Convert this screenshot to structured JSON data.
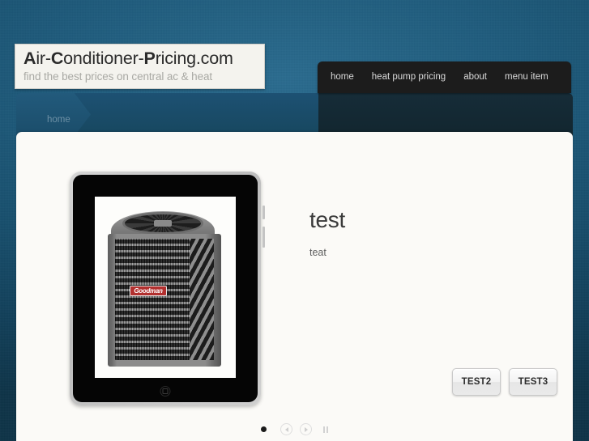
{
  "site": {
    "logo": {
      "title_parts": [
        {
          "text": "A",
          "bold": true
        },
        {
          "text": "ir-",
          "bold": false
        },
        {
          "text": "C",
          "bold": true
        },
        {
          "text": "onditioner-",
          "bold": false
        },
        {
          "text": "P",
          "bold": true
        },
        {
          "text": "ricing.com",
          "bold": false
        }
      ],
      "title_plain": "Air-Conditioner-Pricing.com",
      "tagline": "find the best prices on central ac & heat"
    },
    "background_color": "#1f5c7d",
    "accent_color": "#225a7c"
  },
  "nav": {
    "items": [
      {
        "label": "home"
      },
      {
        "label": "heat pump pricing"
      },
      {
        "label": "about"
      },
      {
        "label": "menu item"
      }
    ]
  },
  "breadcrumb": {
    "current": "home"
  },
  "slide": {
    "device_frame": "ipad-frame",
    "product_image": {
      "alt": "Goodman central air conditioner condenser unit",
      "brand_label": "Goodman",
      "brand_color": "#b2302f"
    },
    "heading": "test",
    "body": "teat",
    "buttons": [
      {
        "label": "TEST2"
      },
      {
        "label": "TEST3"
      }
    ]
  },
  "slider_controls": {
    "pager_dots": [
      {
        "active": true
      }
    ],
    "prev_icon": "prev-arrow-icon",
    "next_icon": "next-arrow-icon",
    "pause_icon": "pause-icon"
  }
}
